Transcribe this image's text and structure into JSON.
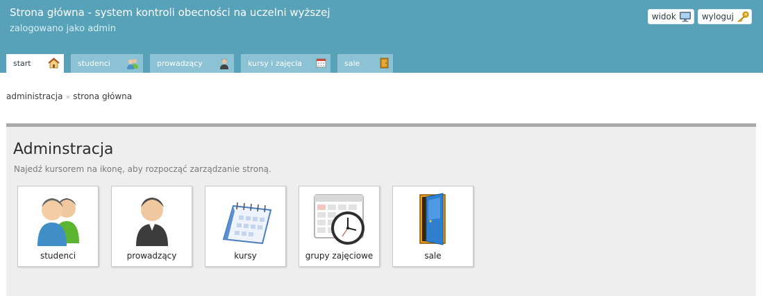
{
  "header": {
    "title": "Strona główna - system kontroli obecności na uczelni wyższej",
    "login_info": "zalogowano jako admin",
    "actions": [
      {
        "label": "widok",
        "icon": "monitor-icon"
      },
      {
        "label": "wyloguj",
        "icon": "key-icon"
      }
    ]
  },
  "tabs": [
    {
      "label": "start",
      "icon": "home-icon",
      "active": true
    },
    {
      "label": "studenci",
      "icon": "users-icon"
    },
    {
      "label": "prowadzący",
      "icon": "teacher-icon"
    },
    {
      "label": "kursy i zajęcia",
      "icon": "calendar-icon"
    },
    {
      "label": "sale",
      "icon": "door-icon"
    }
  ],
  "breadcrumb": [
    "administracja",
    "strona główna"
  ],
  "breadcrumb_separator": "»",
  "panel": {
    "title": "Adminstracja",
    "subtitle": "Najedź kursorem na ikonę, aby rozpocząć zarządzanie stroną.",
    "tiles": [
      {
        "label": "studenci",
        "icon": "users-icon"
      },
      {
        "label": "prowadzący",
        "icon": "teacher-icon"
      },
      {
        "label": "kursy",
        "icon": "calendar-icon"
      },
      {
        "label": "grupy zajęciowe",
        "icon": "schedule-clock-icon"
      },
      {
        "label": "sale",
        "icon": "door-icon"
      }
    ]
  },
  "colors": {
    "header_bg": "#58a2b9",
    "tab_bg": "#8cc3d4",
    "panel_bg": "#eeeeee",
    "panel_border": "#a9a9a9"
  }
}
